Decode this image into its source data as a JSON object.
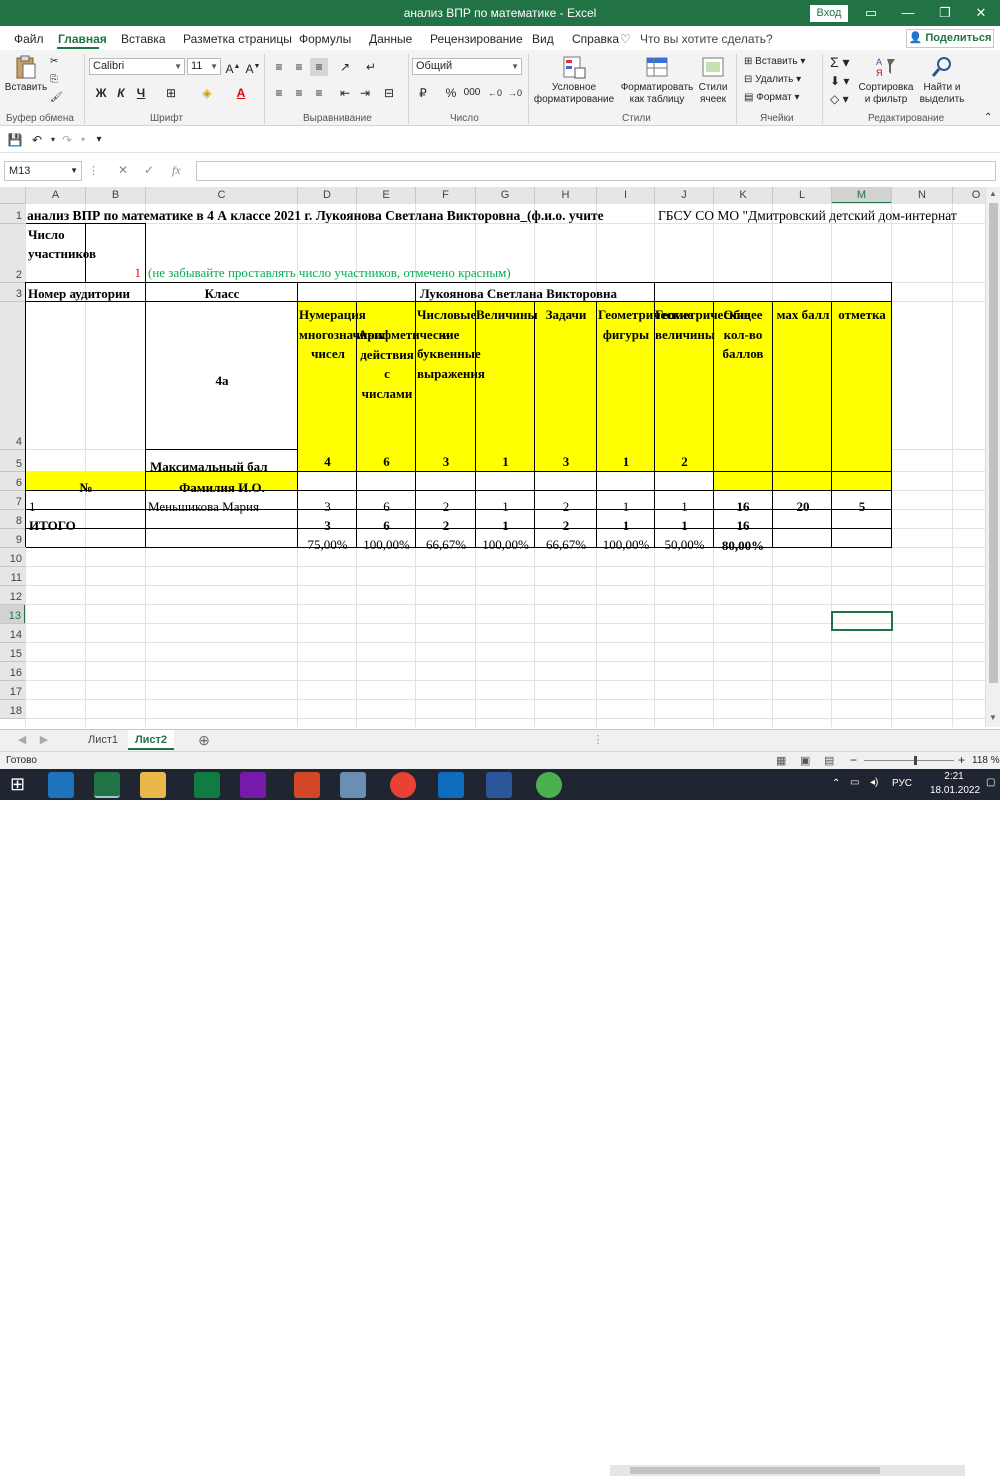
{
  "window": {
    "title": "анализ  ВПР по математике  -  Excel",
    "login": "Вход"
  },
  "ribbon_tabs": [
    "Файл",
    "Главная",
    "Вставка",
    "Разметка страницы",
    "Формулы",
    "Данные",
    "Рецензирование",
    "Вид",
    "Справка"
  ],
  "active_tab": "Главная",
  "tellme": "Что вы хотите сделать?",
  "share": "Поделиться",
  "ribbon": {
    "clipboard": {
      "paste": "Вставить",
      "label": "Буфер обмена"
    },
    "font": {
      "name": "Calibri",
      "size": "11",
      "label": "Шрифт",
      "bold": "Ж",
      "italic": "К",
      "underline": "Ч"
    },
    "alignment": {
      "label": "Выравнивание"
    },
    "number": {
      "format": "Общий",
      "label": "Число",
      "percent": "%",
      "thousands": "000"
    },
    "styles": {
      "conditional": "Условное форматирование",
      "table": "Форматировать как таблицу",
      "cell": "Стили ячеек",
      "label": "Стили"
    },
    "cells": {
      "insert": "Вставить",
      "delete": "Удалить",
      "format": "Формат",
      "label": "Ячейки"
    },
    "editing": {
      "sort": "Сортировка и фильтр",
      "find": "Найти и выделить",
      "label": "Редактирование"
    }
  },
  "namebox": "M13",
  "fx": "fx",
  "columns": [
    "A",
    "B",
    "C",
    "D",
    "E",
    "F",
    "G",
    "H",
    "I",
    "J",
    "K",
    "L",
    "M",
    "N",
    "O"
  ],
  "rows": [
    "1",
    "2",
    "3",
    "4",
    "5",
    "6",
    "7",
    "8",
    "9",
    "10",
    "11",
    "12",
    "13",
    "14",
    "15",
    "16",
    "17",
    "18"
  ],
  "cells": {
    "r1_title": "анализ ВПР по математике в 4 А классе 2021 г. Лукоянова Светлана Викторовна_(ф.и.о. учите",
    "r1_school": "ГБСУ СО МО \"Дмитровский детский дом-интернат",
    "r2_a": "Число участников",
    "r2_b": "1",
    "r2_c": "(не забывайте проставлять число участников, отмечено красным)",
    "r3_a": "Номер аудитории",
    "r3_c": "Класс",
    "r3_f": "Лукоянова Светлана Викторовна",
    "r4_c": "4а",
    "r4_d": "Нумерация многозначных чисел",
    "r4_e": "Арифметические действия с числами",
    "r4_f": "Числовые и буквенные выражения",
    "r4_g": "Величины",
    "r4_h": "Задачи",
    "r4_i": "Геометрические фигуры",
    "r4_j": "Геометрические величины",
    "r4_k": "Общее кол-во баллов",
    "r4_l": "мах балл",
    "r4_m": "отметка",
    "r5_c": "Максимальный  бал",
    "r5_vals": [
      "4",
      "6",
      "3",
      "1",
      "3",
      "1",
      "2"
    ],
    "r6_a": "№",
    "r6_c": "Фамилия И.О.",
    "r7_a": "1",
    "r7_c": "Меньшикова Мария",
    "r7_vals": [
      "3",
      "6",
      "2",
      "1",
      "2",
      "1",
      "1"
    ],
    "r7_k": "16",
    "r7_l": "20",
    "r7_m": "5",
    "r8_a": "ИТОГО",
    "r8_vals": [
      "3",
      "6",
      "2",
      "1",
      "2",
      "1",
      "1"
    ],
    "r8_k": "16",
    "r9_vals": [
      "75,00%",
      "100,00%",
      "66,67%",
      "100,00%",
      "66,67%",
      "100,00%",
      "50,00%"
    ],
    "r9_k": "80,00%"
  },
  "sheets": [
    "Лист1",
    "Лист2"
  ],
  "active_sheet": "Лист2",
  "status": {
    "ready": "Готово",
    "zoom": "118 %"
  },
  "taskbar": {
    "lang": "РУС",
    "time": "2:21",
    "date": "18.01.2022"
  },
  "colors": {
    "excel_green": "#217346",
    "highlight": "#ffff00",
    "red_text": "#ff0000",
    "green_text": "#00b050"
  }
}
